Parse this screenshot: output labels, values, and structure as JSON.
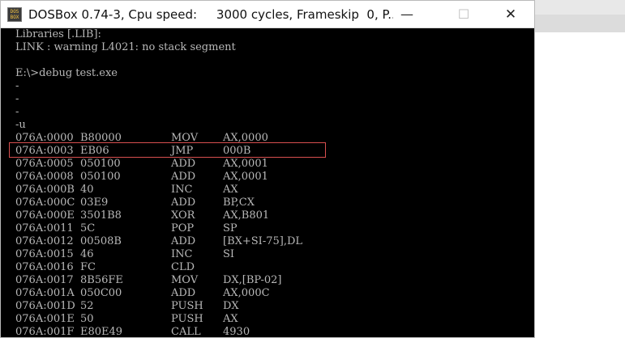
{
  "window": {
    "title": "DOSBox 0.74-3, Cpu speed:     3000 cycles, Frameskip  0, P...",
    "icon_name": "dosbox-icon",
    "icon_text": "DOS BOX",
    "buttons": {
      "minimize": "—",
      "maximize": "☐",
      "close": "✕"
    }
  },
  "console": {
    "header_lines": [
      "Libraries [.LIB]:",
      "LINK : warning L4021: no stack segment",
      "",
      "E:\\>debug test.exe",
      "-",
      "-",
      "-",
      "-u"
    ],
    "disassembly": [
      {
        "addr": "076A:0000",
        "bytes": "B80000",
        "op": "MOV",
        "args": "AX,0000"
      },
      {
        "addr": "076A:0003",
        "bytes": "EB06",
        "op": "JMP",
        "args": "000B",
        "highlighted": true
      },
      {
        "addr": "076A:0005",
        "bytes": "050100",
        "op": "ADD",
        "args": "AX,0001"
      },
      {
        "addr": "076A:0008",
        "bytes": "050100",
        "op": "ADD",
        "args": "AX,0001"
      },
      {
        "addr": "076A:000B",
        "bytes": "40",
        "op": "INC",
        "args": "AX"
      },
      {
        "addr": "076A:000C",
        "bytes": "03E9",
        "op": "ADD",
        "args": "BP,CX"
      },
      {
        "addr": "076A:000E",
        "bytes": "3501B8",
        "op": "XOR",
        "args": "AX,B801"
      },
      {
        "addr": "076A:0011",
        "bytes": "5C",
        "op": "POP",
        "args": "SP"
      },
      {
        "addr": "076A:0012",
        "bytes": "00508B",
        "op": "ADD",
        "args": "[BX+SI-75],DL"
      },
      {
        "addr": "076A:0015",
        "bytes": "46",
        "op": "INC",
        "args": "SI"
      },
      {
        "addr": "076A:0016",
        "bytes": "FC",
        "op": "CLD",
        "args": ""
      },
      {
        "addr": "076A:0017",
        "bytes": "8B56FE",
        "op": "MOV",
        "args": "DX,[BP-02]"
      },
      {
        "addr": "076A:001A",
        "bytes": "050C00",
        "op": "ADD",
        "args": "AX,000C"
      },
      {
        "addr": "076A:001D",
        "bytes": "52",
        "op": "PUSH",
        "args": "DX"
      },
      {
        "addr": "076A:001E",
        "bytes": "50",
        "op": "PUSH",
        "args": "AX"
      },
      {
        "addr": "076A:001F",
        "bytes": "E80E49",
        "op": "CALL",
        "args": "4930"
      }
    ]
  },
  "colors": {
    "console_bg": "#000000",
    "console_text": "#b8b8b8",
    "highlight": "#d84f4f",
    "titlebar_bg": "#ffffff"
  }
}
